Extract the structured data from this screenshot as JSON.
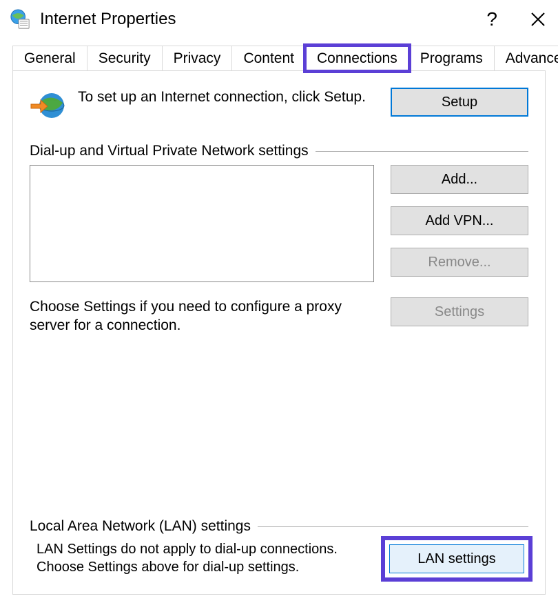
{
  "titlebar": {
    "title": "Internet Properties",
    "help_label": "?",
    "close_label": "✕"
  },
  "tabs": [
    {
      "id": "general",
      "label": "General"
    },
    {
      "id": "security",
      "label": "Security"
    },
    {
      "id": "privacy",
      "label": "Privacy"
    },
    {
      "id": "content",
      "label": "Content"
    },
    {
      "id": "connections",
      "label": "Connections",
      "active": true,
      "highlight": true
    },
    {
      "id": "programs",
      "label": "Programs"
    },
    {
      "id": "advanced",
      "label": "Advanced"
    }
  ],
  "connections": {
    "setup_text": "To set up an Internet connection, click Setup.",
    "setup_button": "Setup",
    "dialup_header": "Dial-up and Virtual Private Network settings",
    "add_button": "Add...",
    "addvpn_button": "Add VPN...",
    "remove_button": "Remove...",
    "settings_button": "Settings",
    "choose_text": "Choose Settings if you need to configure a proxy server for a connection.",
    "lan_header": "Local Area Network (LAN) settings",
    "lan_text": "LAN Settings do not apply to dial-up connections. Choose Settings above for dial-up settings.",
    "lan_button": "LAN settings"
  },
  "icons": {
    "app": "internet-options-icon",
    "globe_arrow": "globe-arrow-icon"
  }
}
